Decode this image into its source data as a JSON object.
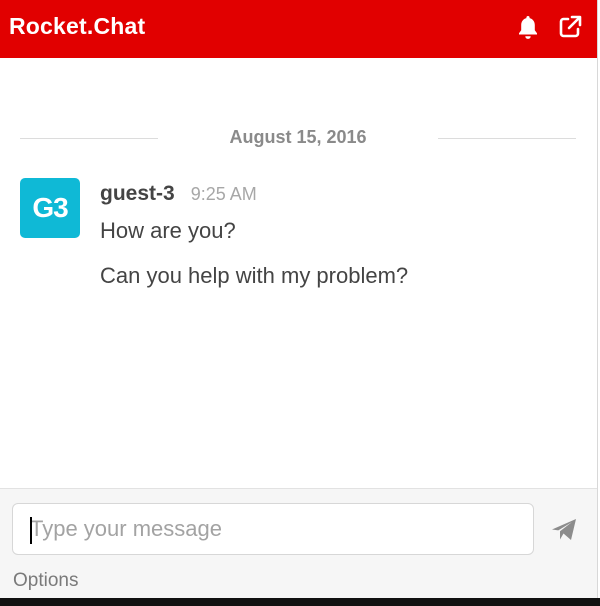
{
  "header": {
    "title": "Rocket.Chat",
    "icons": [
      "bell-icon",
      "external-link-icon"
    ],
    "color": "#e10000"
  },
  "messages": {
    "date_divider": "August 15, 2016",
    "items": [
      {
        "avatar_initials": "G3",
        "avatar_color": "#0fb9d6",
        "username": "guest-3",
        "time": "9:25 AM",
        "lines": [
          "How are you?",
          "Can you help with my problem?"
        ]
      }
    ]
  },
  "composer": {
    "placeholder": "Type your message",
    "value": "",
    "send_icon": "send-icon",
    "options_label": "Options"
  }
}
